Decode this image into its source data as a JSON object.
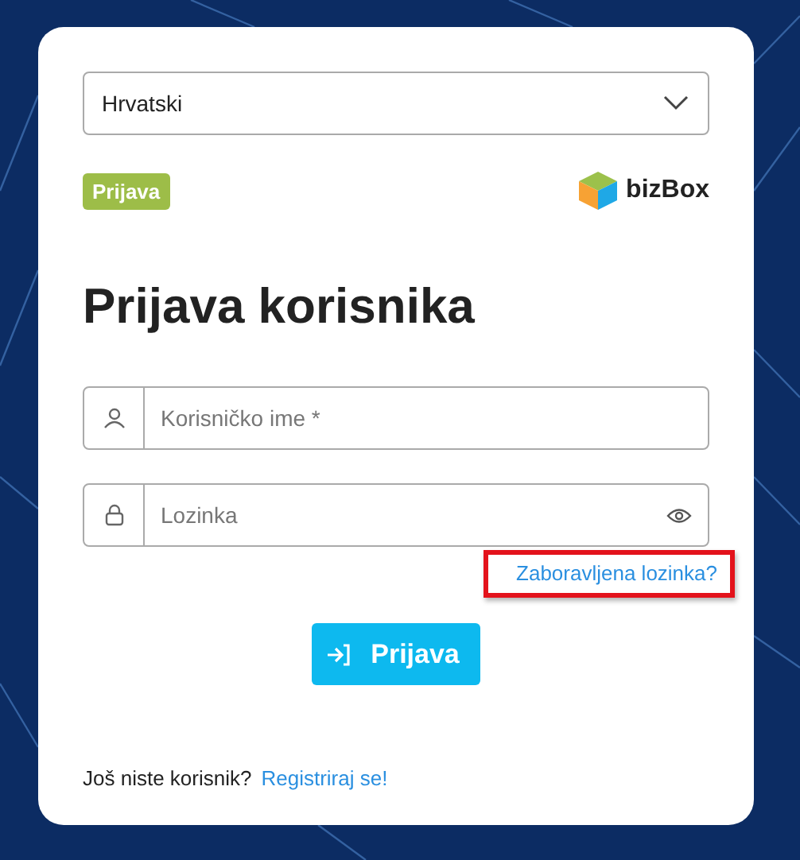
{
  "language_select": {
    "value": "Hrvatski"
  },
  "badge": "Prijava",
  "logo": {
    "text": "bizBox"
  },
  "title": "Prijava korisnika",
  "fields": [
    {
      "kind": "user",
      "placeholder": "Korisničko ime *"
    },
    {
      "kind": "password",
      "placeholder": "Lozinka"
    }
  ],
  "forgot_link": {
    "text": "Zaboravljena lozinka?",
    "highlighted": true
  },
  "login_button": "Prijava",
  "register": {
    "prompt": "Još niste korisnik?",
    "link": "Registriraj se!"
  }
}
